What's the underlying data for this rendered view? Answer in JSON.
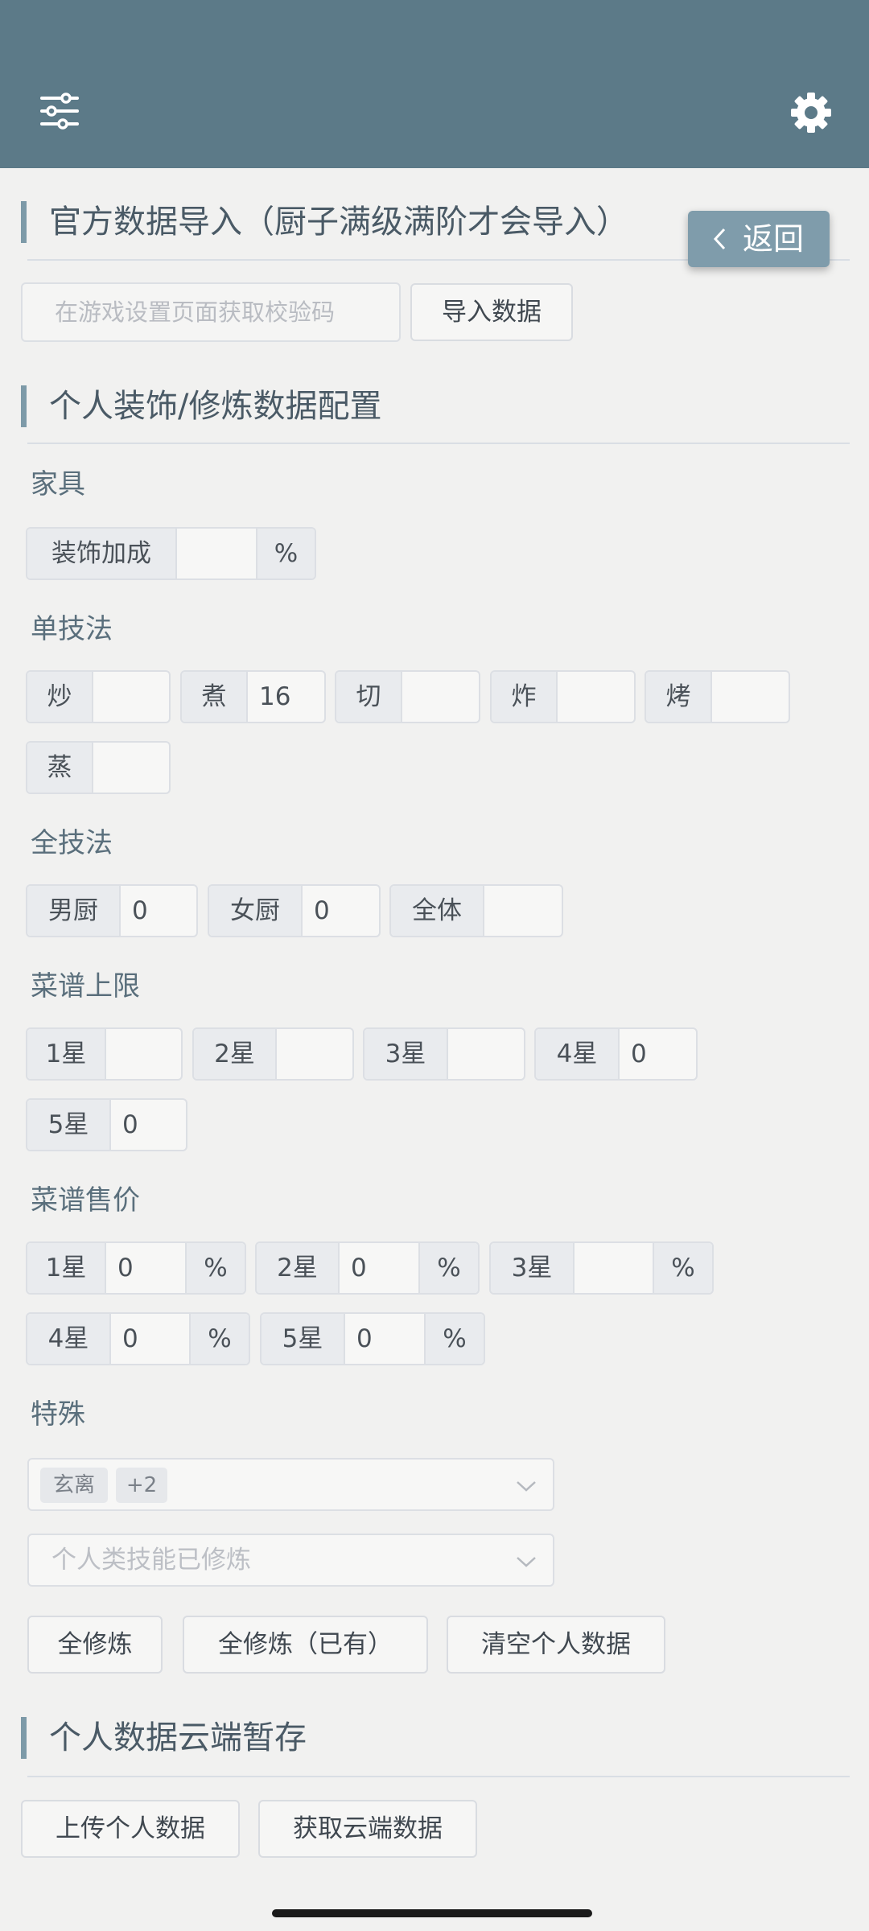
{
  "header": {
    "left_icon": "sliders-icon",
    "right_icon": "gear-icon",
    "bar_color": "#5c7a88"
  },
  "official_import": {
    "title": "官方数据导入（厨子满级满阶才会导入）",
    "back_label": "返回",
    "code_placeholder": "在游戏设置页面获取校验码",
    "import_button": "导入数据"
  },
  "personal_config": {
    "title": "个人装饰/修炼数据配置",
    "furniture": {
      "label": "家具",
      "decor_bonus": {
        "label": "装饰加成",
        "value": "",
        "unit": "%"
      }
    },
    "single_skill": {
      "label": "单技法",
      "fields": [
        {
          "label": "炒",
          "value": ""
        },
        {
          "label": "煮",
          "value": "16"
        },
        {
          "label": "切",
          "value": ""
        },
        {
          "label": "炸",
          "value": ""
        },
        {
          "label": "烤",
          "value": ""
        },
        {
          "label": "蒸",
          "value": ""
        }
      ]
    },
    "all_skill": {
      "label": "全技法",
      "fields": [
        {
          "label": "男厨",
          "value": "0"
        },
        {
          "label": "女厨",
          "value": "0"
        },
        {
          "label": "全体",
          "value": ""
        }
      ]
    },
    "recipe_limit": {
      "label": "菜谱上限",
      "fields": [
        {
          "label": "1星",
          "value": ""
        },
        {
          "label": "2星",
          "value": ""
        },
        {
          "label": "3星",
          "value": ""
        },
        {
          "label": "4星",
          "value": "0"
        },
        {
          "label": "5星",
          "value": "0"
        }
      ]
    },
    "recipe_price": {
      "label": "菜谱售价",
      "unit": "%",
      "fields": [
        {
          "label": "1星",
          "value": "0"
        },
        {
          "label": "2星",
          "value": "0"
        },
        {
          "label": "3星",
          "value": ""
        },
        {
          "label": "4星",
          "value": "0"
        },
        {
          "label": "5星",
          "value": "0"
        }
      ]
    },
    "special": {
      "label": "特殊",
      "select1_tags": [
        "玄离",
        "+2"
      ],
      "select2_placeholder": "个人类技能已修炼"
    },
    "buttons": {
      "all_train": "全修炼",
      "all_train_owned": "全修炼（已有）",
      "clear_personal": "清空个人数据"
    }
  },
  "cloud": {
    "title": "个人数据云端暂存",
    "upload_button": "上传个人数据",
    "fetch_button": "获取云端数据"
  }
}
